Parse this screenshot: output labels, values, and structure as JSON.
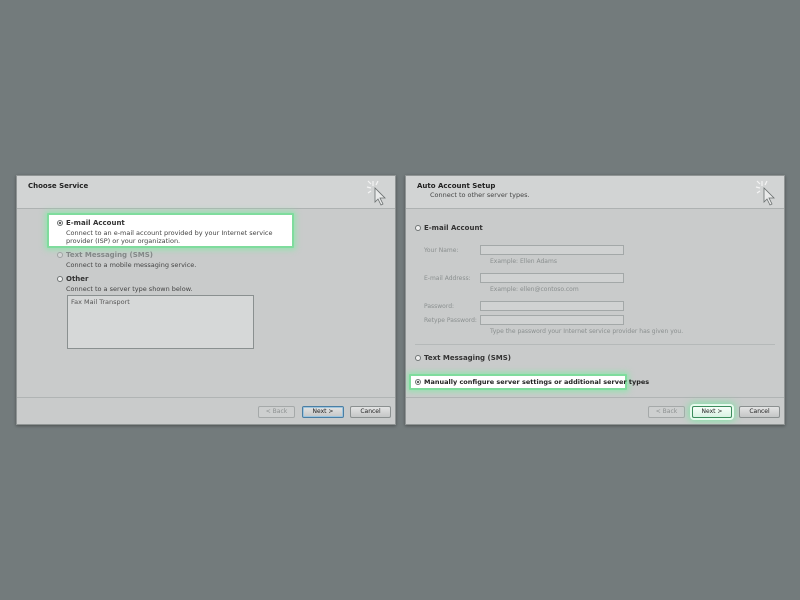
{
  "dialogs": [
    {
      "title": "Choose Service",
      "options": [
        {
          "label": "E-mail Account",
          "description": "Connect to an e-mail account provided by your Internet service provider (ISP) or your organization."
        },
        {
          "label": "Text Messaging (SMS)",
          "description": "Connect to a mobile messaging service."
        },
        {
          "label": "Other",
          "description": "Connect to a server type shown below."
        }
      ],
      "server_types": [
        "Fax Mail Transport"
      ],
      "buttons": {
        "back": "< Back",
        "next": "Next >",
        "cancel": "Cancel"
      }
    },
    {
      "title": "Auto Account Setup",
      "subtitle": "Connect to other server types.",
      "email_option": "E-mail Account",
      "fields": {
        "name_label": "Your Name:",
        "name_example": "Example: Ellen Adams",
        "email_label": "E-mail Address:",
        "email_example": "Example: ellen@contoso.com",
        "password_label": "Password:",
        "retype_label": "Retype Password:",
        "password_hint": "Type the password your Internet service provider has given you."
      },
      "sms_option": "Text Messaging (SMS)",
      "manual_option": "Manually configure server settings or additional server types",
      "buttons": {
        "back": "< Back",
        "next": "Next >",
        "cancel": "Cancel"
      }
    }
  ]
}
